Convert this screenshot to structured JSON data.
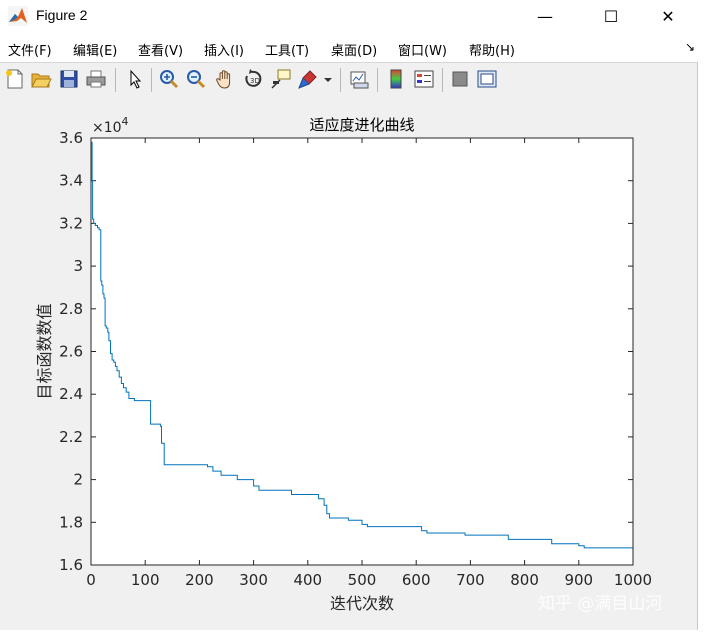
{
  "window": {
    "title": "Figure 2",
    "minimize_glyph": "—",
    "maximize_glyph": "☐",
    "close_glyph": "✕"
  },
  "menu": {
    "items": [
      "文件(F)",
      "编辑(E)",
      "查看(V)",
      "插入(I)",
      "工具(T)",
      "桌面(D)",
      "窗口(W)",
      "帮助(H)"
    ],
    "corner_glyph": "↘"
  },
  "toolbar": {
    "buttons": [
      "new-figure-icon",
      "open-file-icon",
      "save-icon",
      "print-icon",
      "pointer-icon",
      "zoom-in-icon",
      "zoom-out-icon",
      "pan-hand-icon",
      "rotate-3d-icon",
      "data-cursor-icon",
      "brush-icon",
      "dropdown-arrow-icon",
      "link-plot-icon",
      "colorbar-icon",
      "legend-icon",
      "hide-plot-tools-icon",
      "show-plot-tools-icon"
    ]
  },
  "watermark": "知乎 @满目山河",
  "chart_data": {
    "type": "line",
    "title": "适应度进化曲线",
    "xlabel": "迭代次数",
    "ylabel": "目标函数数值",
    "y_exponent_label": "×10",
    "y_exponent": "4",
    "xlim": [
      0,
      1000
    ],
    "ylim": [
      1.6,
      3.6
    ],
    "y_scale_factor": 10000,
    "xticks": [
      0,
      100,
      200,
      300,
      400,
      500,
      600,
      700,
      800,
      900,
      1000
    ],
    "xtick_labels": [
      "0",
      "100",
      "200",
      "300",
      "400",
      "500",
      "600",
      "700",
      "800",
      "900",
      "1000"
    ],
    "yticks": [
      1.6,
      1.8,
      2,
      2.2,
      2.4,
      2.6,
      2.8,
      3,
      3.2,
      3.4,
      3.6
    ],
    "ytick_labels": [
      "1.6",
      "1.8",
      "2",
      "2.2",
      "2.4",
      "2.6",
      "2.8",
      "3",
      "3.2",
      "3.4",
      "3.6"
    ],
    "grid": false,
    "line_color": "#0072bd",
    "series": [
      {
        "x": [
          1,
          2,
          3,
          5,
          8,
          12,
          15,
          18,
          20,
          22,
          24,
          26,
          28,
          31,
          33,
          36,
          39,
          42,
          45,
          48,
          52,
          56,
          60,
          65,
          70,
          80,
          100,
          110,
          128,
          130,
          135,
          160,
          200,
          215,
          225,
          240,
          270,
          300,
          310,
          340,
          370,
          420,
          430,
          435,
          440,
          475,
          500,
          510,
          540,
          570,
          600,
          610,
          620,
          670,
          690,
          700,
          770,
          800,
          850,
          880,
          900,
          910,
          1000
        ],
        "y": [
          3.58,
          3.4,
          3.22,
          3.2,
          3.19,
          3.18,
          3.17,
          2.93,
          2.91,
          2.87,
          2.85,
          2.72,
          2.71,
          2.69,
          2.65,
          2.59,
          2.56,
          2.55,
          2.53,
          2.51,
          2.48,
          2.45,
          2.43,
          2.41,
          2.38,
          2.37,
          2.37,
          2.26,
          2.25,
          2.17,
          2.07,
          2.07,
          2.07,
          2.06,
          2.04,
          2.02,
          2.0,
          1.97,
          1.95,
          1.95,
          1.93,
          1.91,
          1.88,
          1.84,
          1.82,
          1.81,
          1.79,
          1.78,
          1.78,
          1.78,
          1.78,
          1.76,
          1.75,
          1.75,
          1.74,
          1.74,
          1.72,
          1.72,
          1.7,
          1.7,
          1.69,
          1.68,
          1.68
        ]
      }
    ]
  }
}
